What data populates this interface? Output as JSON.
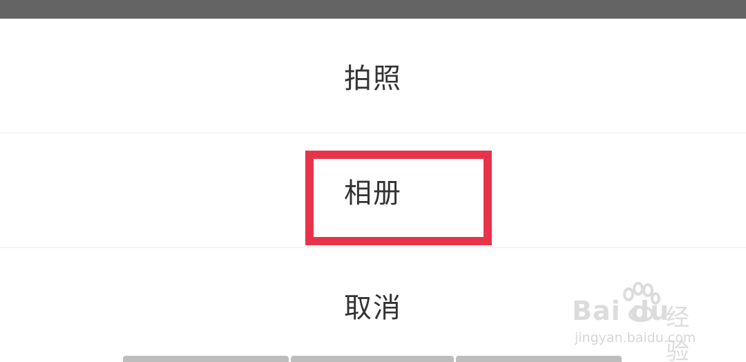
{
  "sheet": {
    "options": [
      {
        "label": "拍照"
      },
      {
        "label": "相册"
      },
      {
        "label": "取消"
      }
    ],
    "highlighted_option": "相册",
    "highlight_color": "#e8344a"
  },
  "watermark": {
    "logo_text": "Bai du",
    "brand_text": "经验",
    "url": "jingyan.baidu.com"
  },
  "colors": {
    "overlay": "#646464",
    "text": "#333333",
    "divider": "#ececec"
  }
}
